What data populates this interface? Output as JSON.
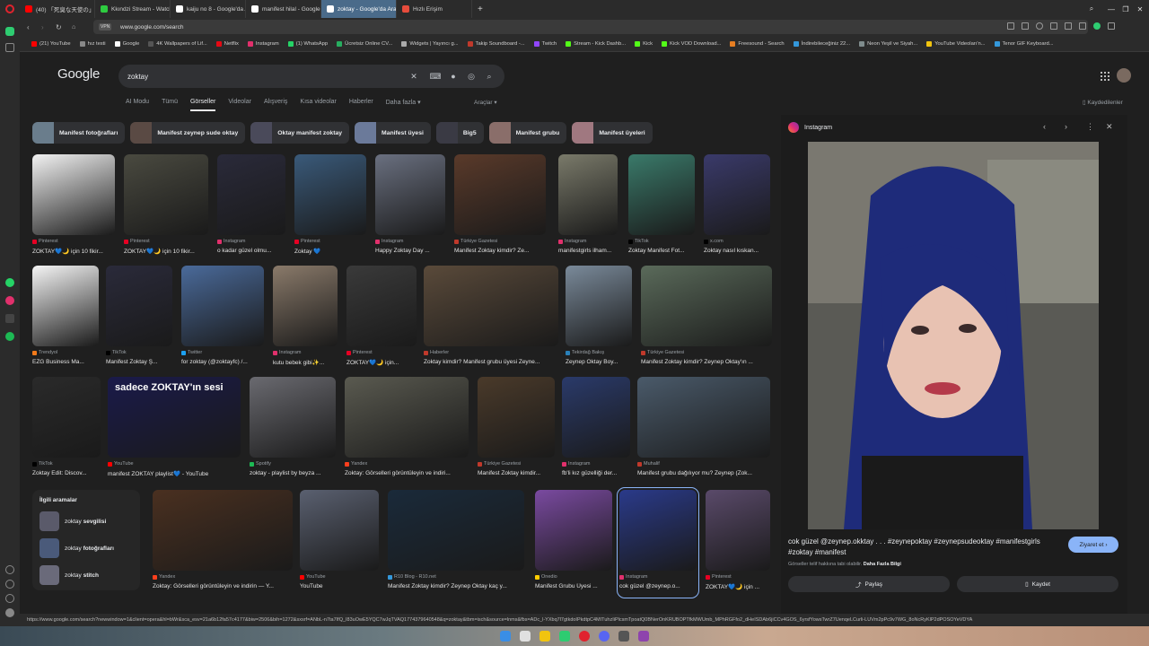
{
  "browser": {
    "tabs": [
      {
        "label": "(40) 「死臭な天使の」",
        "color": "#ff0000",
        "active": false
      },
      {
        "label": "Kkındzi Stream - Watch Li",
        "color": "#2ecc40",
        "active": false
      },
      {
        "label": "kaiju no 8 - Google'da Ara",
        "color": "#ffffff",
        "active": false
      },
      {
        "label": "manifest hilal - Google'da",
        "color": "#ffffff",
        "active": false
      },
      {
        "label": "zoktay - Google'da Ara",
        "color": "#ffffff",
        "active": true
      },
      {
        "label": "Hızlı Erişim",
        "color": "#e74c3c",
        "active": false
      }
    ],
    "new_tab": "+",
    "url": "www.google.com/search",
    "vpn_label": "VPN",
    "bookmarks": [
      {
        "label": "(21) YouTube",
        "color": "#ff0000"
      },
      {
        "label": "hız testi",
        "color": "#888888"
      },
      {
        "label": "Google",
        "color": "#ffffff"
      },
      {
        "label": "4K Wallpapers of Lif...",
        "color": "#555555"
      },
      {
        "label": "Netflix",
        "color": "#e50914"
      },
      {
        "label": "Instagram",
        "color": "#e1306c"
      },
      {
        "label": "(1) WhatsApp",
        "color": "#25d366"
      },
      {
        "label": "Ücretsiz Online CV...",
        "color": "#27ae60"
      },
      {
        "label": "Widgets | Yayıncı g...",
        "color": "#aaaaaa"
      },
      {
        "label": "Takip Soundboard -...",
        "color": "#c0392b"
      },
      {
        "label": "Twitch",
        "color": "#9146ff"
      },
      {
        "label": "Stream - Kick Dashb...",
        "color": "#53fc18"
      },
      {
        "label": "Kick",
        "color": "#53fc18"
      },
      {
        "label": "Kick VOD Download...",
        "color": "#53fc18"
      },
      {
        "label": "Freesound - Search",
        "color": "#e67e22"
      },
      {
        "label": "İndirebileceğiniz 22...",
        "color": "#3498db"
      },
      {
        "label": "Neon Yeşil ve Siyah...",
        "color": "#7f8c8d"
      },
      {
        "label": "YouTube Videoları'n...",
        "color": "#f1c40f"
      },
      {
        "label": "Tenor GIF Keyboard...",
        "color": "#3498db"
      }
    ],
    "status_url": "https://www.google.com/search?newwindow=1&client=opera&hl=bWr&sca_esv=21a6b12fa57c4177&biw=2506&bih=1272&sxsrf=ANbL-n7ta7IfQ_I83uOwE5YQC7wJqTVAQ1774379640548&q=zoktay&tbm=isch&source=lnms&fbs=ADc_l-YXbq7l7gtkdoIPkdtpC4MITuhzIiPlcsmTpoatQ0BNerOnKRUBOPTfkMWUmb_MPhRGFfo2_dHeISDAb6jiCCv4GOS_6yrsfYowsTwrZ7UenqeLCurli-LUVm2pPc9v7WG_8oNcRyKlP2dPOSOYeVDYA"
  },
  "google": {
    "logo": "Google",
    "query": "zoktay",
    "nav_tabs": [
      "AI Modu",
      "Tümü",
      "Görseller",
      "Videolar",
      "Alışveriş",
      "Kısa videolar",
      "Haberler",
      "Daha fazla ▾"
    ],
    "tools": "Araçlar ▾",
    "saved": "Kaydedilenler",
    "chips": [
      {
        "label": "Manifest fotoğrafları",
        "color": "#6a7d8c"
      },
      {
        "label": "Manifest zeynep sude oktay",
        "color": "#5a4a44"
      },
      {
        "label": "Oktay manifest zoktay",
        "color": "#4a4a5a"
      },
      {
        "label": "Manifest üyesi",
        "color": "#6b7a9a"
      },
      {
        "label": "Big5",
        "color": "#3a3a44"
      },
      {
        "label": "Manifest grubu",
        "color": "#8a6e6a"
      },
      {
        "label": "Manifest üyeleri",
        "color": "#a07880"
      }
    ],
    "results": [
      {
        "source": "Pinterest",
        "caption": "ZOKTAY💙🌙 için 10 fikir...",
        "color": "#f2f2f2",
        "srccolor": "#e60023"
      },
      {
        "source": "Pinterest",
        "caption": "ZOKTAY💙🌙 için 10 fikir...",
        "color": "#4a4a40",
        "srccolor": "#e60023"
      },
      {
        "source": "Instagram",
        "caption": "o kadar güzel olmu...",
        "color": "#2a2a3a",
        "srccolor": "#e1306c"
      },
      {
        "source": "Pinterest",
        "caption": "Zoktay 💙",
        "color": "#3a5a7a",
        "srccolor": "#e60023"
      },
      {
        "source": "Instagram",
        "caption": "Happy Zoktay Day ...",
        "color": "#6a7080",
        "srccolor": "#e1306c"
      },
      {
        "source": "Türkiye Gazetesi",
        "caption": "Manifest Zoktay kimdir? Ze...",
        "color": "#5a3a2a",
        "srccolor": "#c0392b"
      },
      {
        "source": "Instagram",
        "caption": "manifestgirls ilham...",
        "color": "#7a7a6a",
        "srccolor": "#e1306c"
      },
      {
        "source": "TikTok",
        "caption": "Zoktay Manifest Fot...",
        "color": "#3a7a6a",
        "srccolor": "#000000"
      },
      {
        "source": "x.com",
        "caption": "Zoktay nasıl kıskan...",
        "color": "#3a3a6a",
        "srccolor": "#000000"
      },
      {
        "source": "Trendyol",
        "caption": "EZG Business Ma...",
        "color": "#f5f5f5",
        "srccolor": "#f27a1a"
      },
      {
        "source": "TikTok",
        "caption": "Manifest Zoktay Ş...",
        "color": "#2a2a3a",
        "srccolor": "#000000"
      },
      {
        "source": "Twitter",
        "caption": "for zoktay (@zoktayfc) /...",
        "color": "#4a6a9a",
        "srccolor": "#1da1f2"
      },
      {
        "source": "Instagram",
        "caption": "kutu bebek gibi✨...",
        "color": "#8a7a6a",
        "srccolor": "#e1306c"
      },
      {
        "source": "Pinterest",
        "caption": "ZOKTAY💙🌙 için...",
        "color": "#3a3a3a",
        "srccolor": "#e60023"
      },
      {
        "source": "Haberler",
        "caption": "Zoktay kimdir? Manifest grubu üyesi Zeyne...",
        "color": "#5a4a3a",
        "srccolor": "#c0392b"
      },
      {
        "source": "Tekirdağ Bakış",
        "caption": "Zeynep Oktay Boy...",
        "color": "#7a8a9a",
        "srccolor": "#2980b9"
      },
      {
        "source": "Türkiye Gazetesi",
        "caption": "Manifest Zoktay kimdir? Zeynep Oktay'ın ...",
        "color": "#5a6a5a",
        "srccolor": "#c0392b"
      },
      {
        "source": "TikTok",
        "caption": "Zoktay Edit: Discov...",
        "color": "#2a2a2a",
        "srccolor": "#000000"
      },
      {
        "source": "YouTube",
        "caption": "manifest ZOKTAY playlist💙 - YouTube",
        "color": "#1a1a4a",
        "srccolor": "#ff0000"
      },
      {
        "source": "Spotify",
        "caption": "zoktay - playlist by beyza ...",
        "color": "#6a6a70",
        "srccolor": "#1db954"
      },
      {
        "source": "Yandex",
        "caption": "Zoktay: Görselleri görüntüleyin ve indiri...",
        "color": "#5a5a50",
        "srccolor": "#fc3f1d"
      },
      {
        "source": "Türkiye Gazetesi",
        "caption": "Manifest Zoktay kimdir...",
        "color": "#4a3a2a",
        "srccolor": "#c0392b"
      },
      {
        "source": "Instagram",
        "caption": "fb'li kız güzelliği der...",
        "color": "#2a3a6a",
        "srccolor": "#e1306c"
      },
      {
        "source": "Muhalif",
        "caption": "Manifest grubu dağılıyor mu? Zeynep (Zok...",
        "color": "#4a5a6a",
        "srccolor": "#c0392b"
      },
      {
        "source": "Yandex",
        "caption": "Zoktay: Görselleri görüntüleyin ve indirin — Y...",
        "color": "#4a3020",
        "srccolor": "#fc3f1d"
      },
      {
        "source": "YouTube",
        "caption": "YouTube",
        "color": "#5a6070",
        "srccolor": "#ff0000"
      },
      {
        "source": "R10 Blog - R10.net",
        "caption": "Manifest Zoktay kimdir? Zeynep Oktay kaç y...",
        "color": "#1a2a3a",
        "srccolor": "#3498db"
      },
      {
        "source": "Onedio",
        "caption": "Manifest Grubu Üyesi ...",
        "color": "#7a4aa0",
        "srccolor": "#ffcc00"
      },
      {
        "source": "Instagram",
        "caption": "cok güzel @zeynep.o...",
        "color": "#2a3a8a",
        "srccolor": "#e1306c"
      },
      {
        "source": "Pinterest",
        "caption": "ZOKTAY💙🌙 için ...",
        "color": "#5a4a6a",
        "srccolor": "#e60023"
      }
    ],
    "youtube_overlay": "sadece ZOKTAY'ın sesi",
    "related_title": "İlgili aramalar",
    "related": [
      {
        "prefix": "zoktay ",
        "bold": "sevgilisi",
        "color": "#5a5a6a"
      },
      {
        "prefix": "zoktay ",
        "bold": "fotoğrafları",
        "color": "#4a5a7a"
      },
      {
        "prefix": "zoktay ",
        "bold": "stitch",
        "color": "#6a6a7a"
      }
    ]
  },
  "preview": {
    "source": "Instagram",
    "caption": "cok güzel @zeynep.okktay . . . #zeynepoktay #zeynepsudeoktay #manifestgirls #zoktay #manifest",
    "license_text": "Görseller telif hakkına tabi olabilir.",
    "license_link": "Daha Fazla Bilgi",
    "visit_label": "Ziyaret et",
    "share_label": "Paylaş",
    "save_label": "Kaydet"
  }
}
